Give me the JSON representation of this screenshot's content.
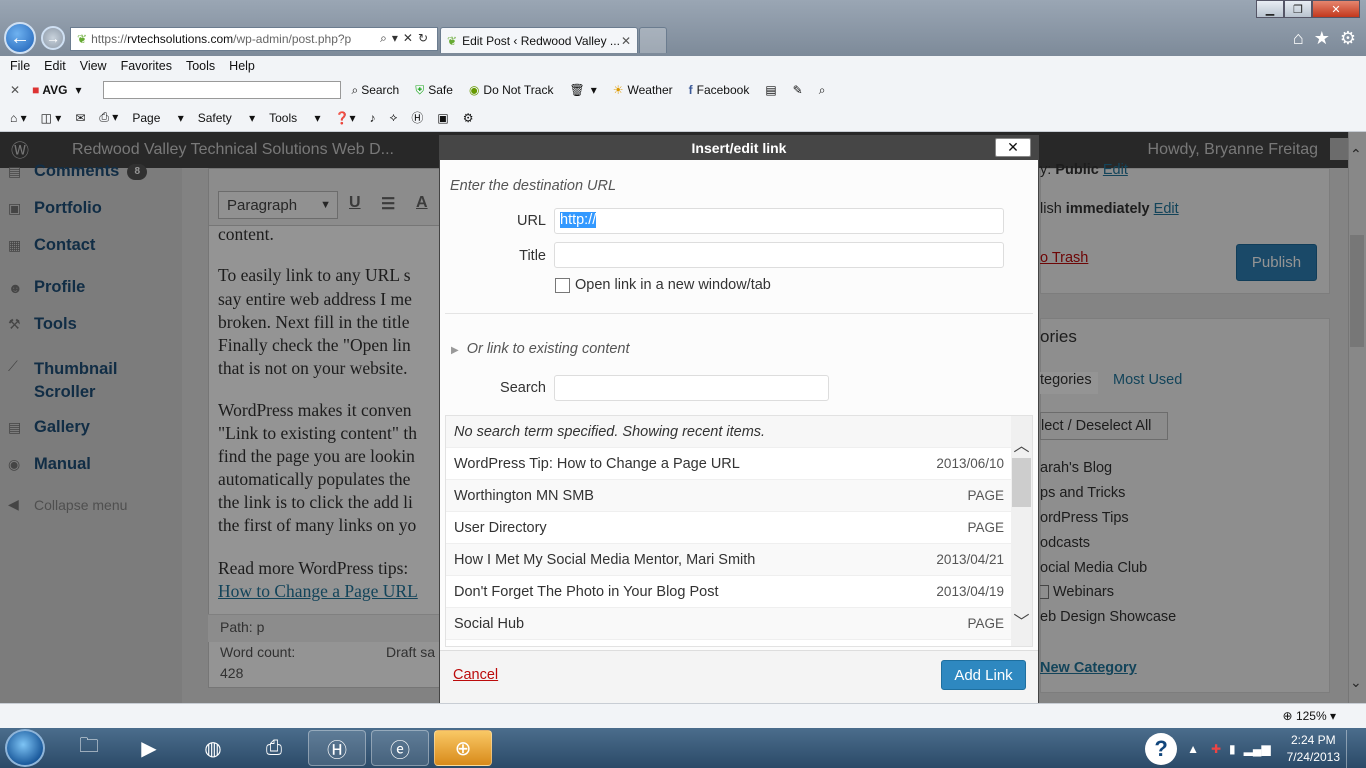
{
  "browser": {
    "url_prefix": "https://",
    "url_host": "rvtechsolutions.com",
    "url_path": "/wp-admin/post.php?p",
    "tab_title": "Edit Post ‹ Redwood Valley ...",
    "menu": [
      "File",
      "Edit",
      "View",
      "Favorites",
      "Tools",
      "Help"
    ],
    "avg": {
      "brand": "AVG",
      "search_label": "Search",
      "safe": "Safe",
      "do_not_track": "Do Not Track",
      "weather": "Weather",
      "facebook": "Facebook"
    },
    "command": {
      "page": "Page",
      "safety": "Safety",
      "tools": "Tools"
    },
    "zoom": "125%"
  },
  "wp": {
    "site_name": "Redwood Valley Technical Solutions Web D...",
    "howdy": "Howdy, Bryanne Freitag",
    "sidebar": {
      "comments": "Comments",
      "comments_count": "8",
      "portfolio": "Portfolio",
      "contact": "Contact",
      "profile": "Profile",
      "tools": "Tools",
      "thumbnail_1": "Thumbnail",
      "thumbnail_2": "Scroller",
      "gallery": "Gallery",
      "manual": "Manual",
      "collapse": "Collapse menu"
    },
    "editor": {
      "paragraph": "Paragraph",
      "lines": [
        "content.",
        "To easily link to any URL s",
        "say entire web address I me",
        "broken. Next fill in the title",
        "Finally check the \"Open lin",
        "that is not on your website.",
        "WordPress makes it conven",
        "\"Link to existing content\" th",
        "find the page you are lookin",
        "automatically populates the",
        "the link is to click the add li",
        "the first of many links on yo",
        "Read more WordPress tips:"
      ],
      "link_line": "How to Change a Page URL",
      "path": "Path: p",
      "word_count_label": "Word count:",
      "word_count": "428",
      "draft": "Draft sa"
    },
    "right": {
      "visibility_pre": "y:",
      "visibility": "Public",
      "edit1": "Edit",
      "publish_pre": "lish",
      "publish_when": "immediately",
      "edit2": "Edit",
      "trash": "o Trash",
      "publish_btn": "Publish",
      "categories_title": "ories",
      "tab_all": "tegories",
      "tab_most": "Most Used",
      "select_all": "lect / Deselect All",
      "cats": [
        "arah's Blog",
        "ps and Tricks",
        "ordPress Tips",
        "odcasts",
        "ocial Media Club",
        "Webinars",
        "eb Design Showcase"
      ],
      "new_cat": "New Category"
    }
  },
  "dialog": {
    "title": "Insert/edit link",
    "close": "✕",
    "enter_url": "Enter the destination URL",
    "url_label": "URL",
    "url_value": "http://",
    "title_label": "Title",
    "new_window": "Open link in a new window/tab",
    "existing": "Or link to existing content",
    "search_label": "Search",
    "no_search": "No search term specified. Showing recent items.",
    "results": [
      {
        "title": "WordPress Tip: How to Change a Page URL",
        "meta": "2013/06/10"
      },
      {
        "title": "Worthington MN SMB",
        "meta": "PAGE"
      },
      {
        "title": "User Directory",
        "meta": "PAGE"
      },
      {
        "title": "How I Met My Social Media Mentor, Mari Smith",
        "meta": "2013/04/21"
      },
      {
        "title": "Don't Forget The Photo in Your Blog Post",
        "meta": "2013/04/19"
      },
      {
        "title": "Social Hub",
        "meta": "PAGE"
      }
    ],
    "cancel": "Cancel",
    "add_link": "Add Link"
  },
  "taskbar": {
    "time": "2:24 PM",
    "date": "7/24/2013"
  }
}
